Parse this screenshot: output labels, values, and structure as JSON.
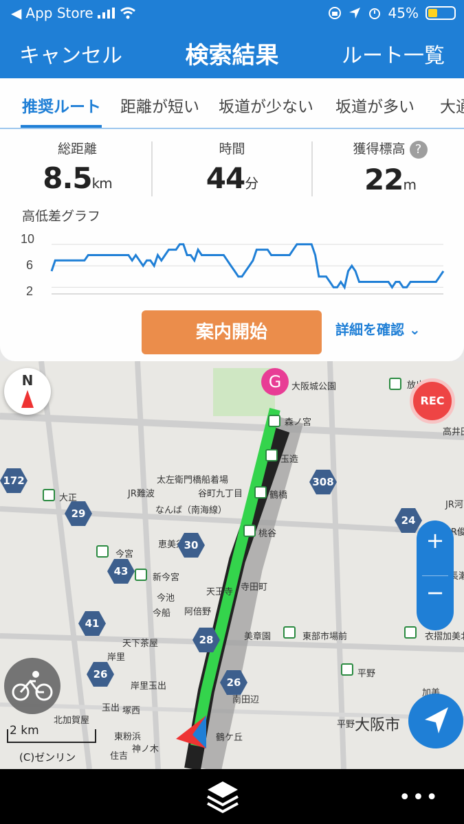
{
  "status_bar": {
    "back_app": "App Store",
    "battery": "45%"
  },
  "nav": {
    "cancel": "キャンセル",
    "title": "検索結果",
    "route_list": "ルート一覧"
  },
  "tabs": [
    "推奨ルート",
    "距離が短い",
    "坂道が少ない",
    "坂道が多い",
    "大通"
  ],
  "stats": {
    "distance": {
      "label": "総距離",
      "value": "8.5",
      "unit": "km"
    },
    "time": {
      "label": "時間",
      "value": "44",
      "unit": "分"
    },
    "elevation": {
      "label": "獲得標高",
      "value": "22",
      "unit": "m"
    }
  },
  "graph": {
    "title": "高低差グラフ",
    "y_ticks": [
      "10",
      "6",
      "2"
    ]
  },
  "chart_data": {
    "type": "line",
    "title": "高低差グラフ",
    "ylim": [
      0,
      11
    ],
    "series": [
      {
        "values": [
          5,
          7,
          7,
          7,
          7,
          7,
          7,
          7,
          7,
          7,
          8,
          8,
          8,
          8,
          8,
          8,
          8,
          8,
          8,
          8,
          8,
          8,
          7,
          8,
          7,
          6,
          7,
          7,
          6,
          8,
          7,
          8,
          9,
          9,
          9,
          10,
          10,
          8,
          8,
          7,
          9,
          8,
          8,
          8,
          8,
          8,
          8,
          8,
          7,
          6,
          5,
          4,
          4,
          5,
          6,
          7,
          9,
          9,
          9,
          9,
          8,
          8,
          8,
          8,
          8,
          8,
          9,
          10,
          10,
          10,
          10,
          10,
          8,
          4,
          4,
          4,
          3,
          2,
          2,
          3,
          2,
          5,
          6,
          5,
          3,
          3,
          3,
          3,
          3,
          3,
          3,
          3,
          3,
          2,
          3,
          3,
          2,
          2,
          3,
          3,
          3,
          3,
          3,
          3,
          3,
          3,
          4,
          5
        ]
      }
    ],
    "color": "#1f7fd6",
    "grid": true
  },
  "actions": {
    "start": "案内開始",
    "details": "詳細を確認"
  },
  "map": {
    "labels": [
      "大阪城公園",
      "森ノ宮",
      "玉造",
      "鶴橋",
      "桃谷",
      "寺田町",
      "天王寺",
      "美章園",
      "南田辺",
      "鶴ケ丘",
      "東部市場前",
      "衣摺加美北",
      "平野",
      "加美",
      "大阪市",
      "太左衛門橋船着場",
      "JR難波",
      "谷町九丁目",
      "なんば（南海線）",
      "恵美須町",
      "今宮",
      "新今宮",
      "今池",
      "今船",
      "阿倍野",
      "天下茶屋",
      "岸里",
      "岸里玉出",
      "玉出",
      "塚西",
      "北加賀屋",
      "東粉浜",
      "神ノ木",
      "住吉",
      "大正",
      "放出",
      "高井田",
      "JR河",
      "JR俊",
      "長瀬",
      "平野"
    ],
    "routes": [
      "172",
      "29",
      "30",
      "43",
      "41",
      "26",
      "28",
      "26",
      "308",
      "24"
    ],
    "compass": "N",
    "rec": "REC",
    "goal": "G",
    "scale": "2 km",
    "copyright": "(C)ゼンリン"
  },
  "colors": {
    "primary": "#1f7fd6",
    "start_button": "#eb8d4b",
    "route": "#34d44c",
    "goal_pin": "#e83d95"
  },
  "icons": [
    "back-arrow-icon",
    "signal-icon",
    "wifi-icon",
    "orientation-lock-icon",
    "location-icon",
    "alarm-icon",
    "battery-icon",
    "help-icon",
    "chevron-down-icon",
    "compass-icon",
    "bike-icon",
    "locate-arrow-icon",
    "zoom-in-icon",
    "zoom-out-icon",
    "layers-icon",
    "more-icon"
  ]
}
